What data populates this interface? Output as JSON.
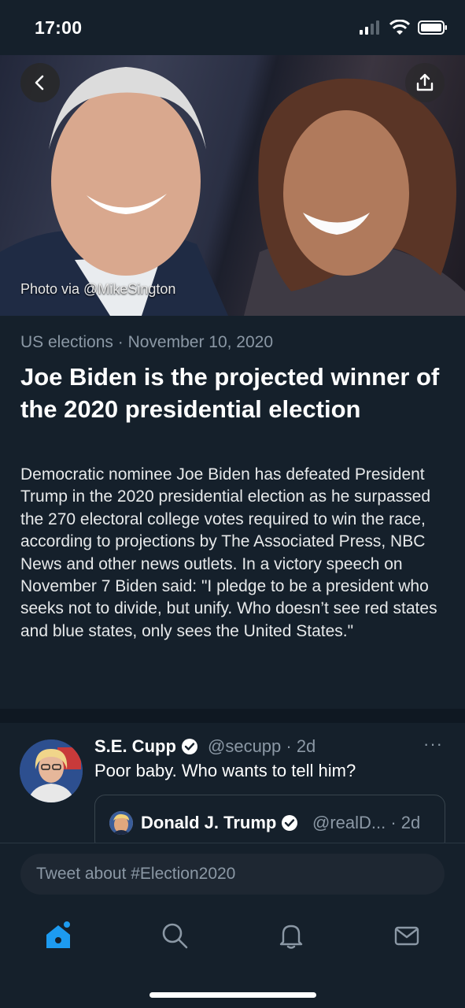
{
  "status_bar": {
    "time": "17:00"
  },
  "hero": {
    "photo_credit": "Photo via @MikeSington"
  },
  "article": {
    "category": "US elections",
    "separator": "·",
    "date": "November 10, 2020",
    "headline": "Joe Biden is the projected winner of the 2020 presidential election",
    "summary": "Democratic nominee Joe Biden has defeated President Trump in the 2020 presidential election as he surpassed the 270 electoral college votes required to win the race, according to projections by The Associated Press, NBC News and other news outlets. In a victory speech on November 7 Biden said: \"I pledge to be a president who seeks not to divide, but unify. Who doesn’t see red states and blue states, only sees the United States.\""
  },
  "tweet": {
    "name": "S.E. Cupp",
    "handle_time": "@secupp · 2d",
    "text": "Poor baby. Who wants to tell him?",
    "more": "···",
    "quote": {
      "name": "Donald J. Trump",
      "handle_time": "@realD... · 2d"
    }
  },
  "compose": {
    "placeholder": "Tweet about #Election2020"
  },
  "colors": {
    "accent": "#1d9bf0",
    "background": "#15202b",
    "secondary_text": "#8b98a5"
  },
  "icons": [
    "back-arrow-icon",
    "share-icon",
    "verified-badge-icon",
    "home-icon",
    "search-icon",
    "bell-icon",
    "mail-icon"
  ]
}
